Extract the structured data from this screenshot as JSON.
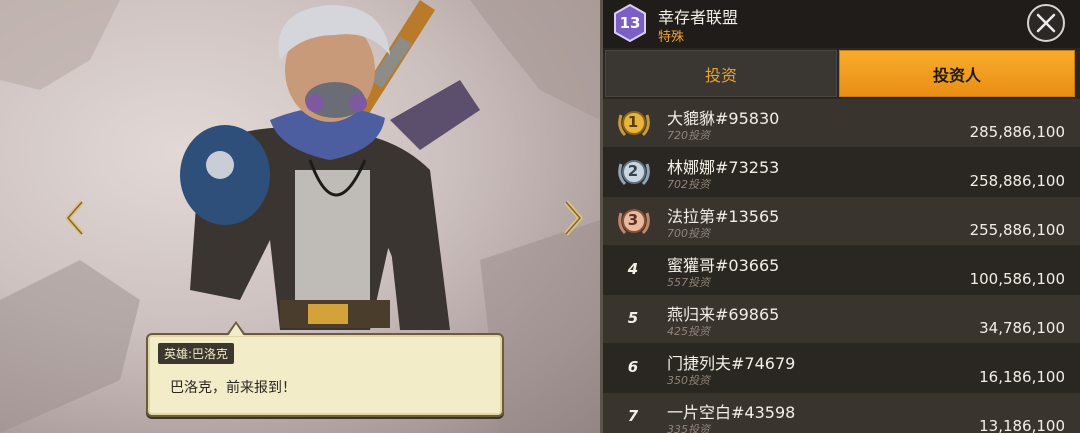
{
  "header": {
    "level": "13",
    "alliance_name": "幸存者联盟",
    "alliance_subtitle": "特殊"
  },
  "tabs": [
    {
      "label": "投资",
      "active": false
    },
    {
      "label": "投资人",
      "active": true
    }
  ],
  "investors": [
    {
      "rank": "1",
      "name": "大貔貅#95830",
      "count": "720投资",
      "amount": "285,886,100",
      "medal": "gold-medal-icon"
    },
    {
      "rank": "2",
      "name": "林娜娜#73253",
      "count": "702投资",
      "amount": "258,886,100",
      "medal": "silver-medal-icon"
    },
    {
      "rank": "3",
      "name": "法拉第#13565",
      "count": "700投资",
      "amount": "255,886,100",
      "medal": "bronze-medal-icon"
    },
    {
      "rank": "4",
      "name": "蜜獾哥#03665",
      "count": "557投资",
      "amount": "100,586,100"
    },
    {
      "rank": "5",
      "name": "燕归来#69865",
      "count": "425投资",
      "amount": "34,786,100"
    },
    {
      "rank": "6",
      "name": "门捷列夫#74679",
      "count": "350投资",
      "amount": "16,186,100"
    },
    {
      "rank": "7",
      "name": "一片空白#43598",
      "count": "335投资",
      "amount": "13,186,100"
    }
  ],
  "dialog": {
    "speaker": "英雄:巴洛克",
    "text": "巴洛克，前来报到！"
  },
  "colors": {
    "accent_orange": "#f0a332",
    "badge_purple": "#7b5fc6",
    "panel_bg": "#2a2622"
  }
}
